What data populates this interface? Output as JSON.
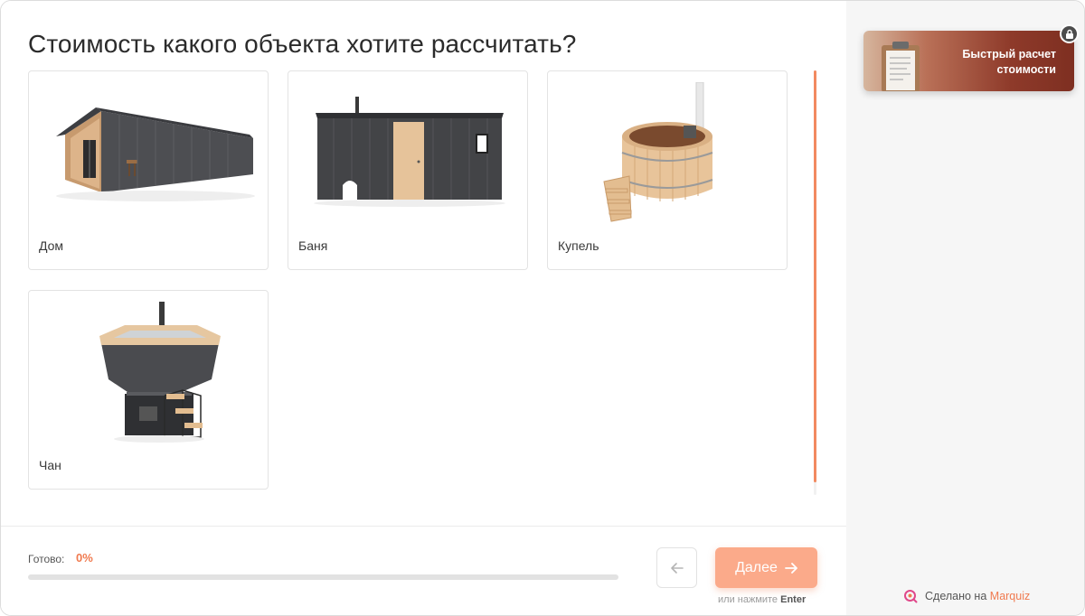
{
  "quiz": {
    "question": "Стоимость какого объекта хотите рассчитать?",
    "options": [
      {
        "label": "Дом",
        "icon": "modular-house-image"
      },
      {
        "label": "Баня",
        "icon": "sauna-cabin-image"
      },
      {
        "label": "Купель",
        "icon": "wooden-hot-tub-image"
      },
      {
        "label": "Чан",
        "icon": "octagonal-vat-image"
      }
    ]
  },
  "footer": {
    "progress_label": "Готово:",
    "progress_value": "0%",
    "progress_fraction": 0,
    "back_icon": "arrow-left-icon",
    "next_label": "Далее",
    "next_icon": "arrow-right-icon",
    "hint_prefix": "или нажмите",
    "hint_key": "Enter"
  },
  "sidebar": {
    "promo_line1": "Быстрый расчет",
    "promo_line2": "стоимости",
    "lock_icon": "lock-icon",
    "made_by_prefix": "Сделано на",
    "made_by_brand": "Marquiz",
    "brand_icon": "marquiz-logo-icon"
  },
  "colors": {
    "accent": "#f07a4f",
    "next_button": "#fbaa8a",
    "sidebar_bg": "#f6f6f6"
  }
}
